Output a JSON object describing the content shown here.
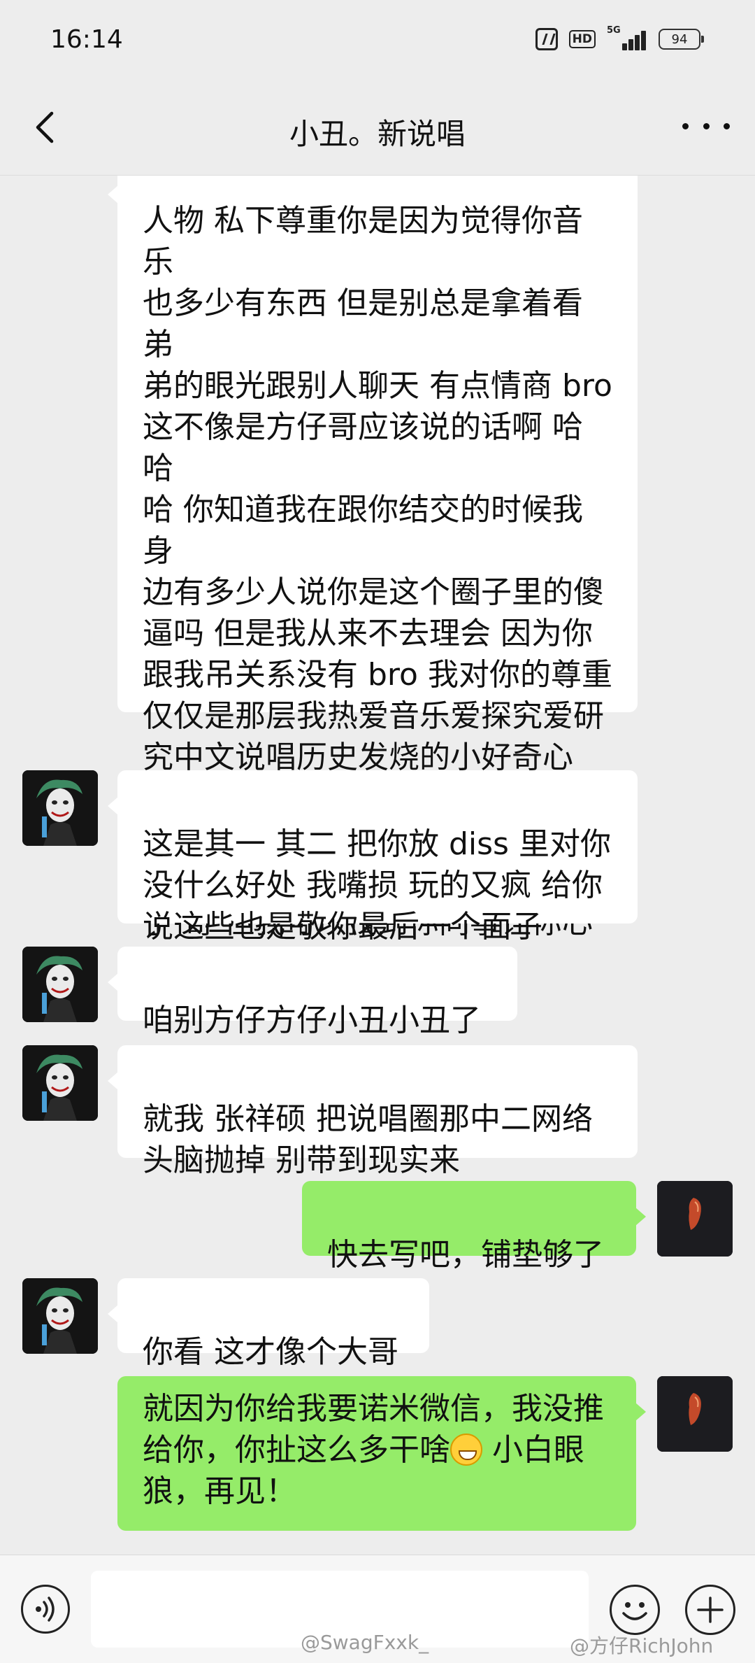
{
  "status_bar": {
    "time": "16:14",
    "hd_label": "HD",
    "network_label": "5G",
    "battery_level": "94"
  },
  "header": {
    "title": "小丑。新说唱"
  },
  "messages": [
    {
      "side": "in",
      "show_avatar": false,
      "text": "人物 私下尊重你是因为觉得你音乐\n也多少有东西 但是别总是拿着看弟\n弟的眼光跟别人聊天 有点情商 bro\n这不像是方仔哥应该说的话啊 哈哈\n哈 你知道我在跟你结交的时候我身\n边有多少人说你是这个圈子里的傻\n逼吗 但是我从来不去理会 因为你\n跟我吊关系没有 bro 我对你的尊重\n仅仅是那层我热爱音乐爱探究爱研\n究中文说唱历史发烧的小好奇心 失\n去这层尊重就不好玩了 bro 你之前\n哪个单位的在当地 我知道你不干\n了 哥 但我可以找到你同事让你心\n平气和的跟我聊天"
    },
    {
      "side": "in",
      "show_avatar": true,
      "text": "这是其一 其二 把你放 diss 里对你\n没什么好处 我嘴损 玩的又疯 给你\n说这些也是敬你最后一个面子"
    },
    {
      "side": "in",
      "show_avatar": true,
      "text": "咱别方仔方仔小丑小丑了"
    },
    {
      "side": "in",
      "show_avatar": true,
      "text": "就我 张祥硕 把说唱圈那中二网络\n头脑抛掉 别带到现实来"
    },
    {
      "side": "out",
      "show_avatar": true,
      "text": "快去写吧，铺垫够了"
    },
    {
      "side": "in",
      "show_avatar": true,
      "text": "你看 这才像个大哥"
    },
    {
      "side": "out",
      "show_avatar": true,
      "text_line1": "就因为你给我要诺米微信，我没推",
      "text_line2a": "给你，你扯这么多干啥",
      "emoji_name": "grin-emoji",
      "text_line2b": " 小白眼",
      "text_line3": "狼，再见！"
    }
  ],
  "watermarks": [
    "@SwagFxxk_",
    "@方仔RichJohn"
  ],
  "colors": {
    "background": "#ededed",
    "incoming_bubble": "#ffffff",
    "outgoing_bubble": "#95ec69"
  },
  "icons": {
    "back": "chevron-left-icon",
    "more": "more-dots-icon",
    "voice": "voice-icon",
    "emoji": "smiley-icon",
    "plus": "plus-icon"
  }
}
